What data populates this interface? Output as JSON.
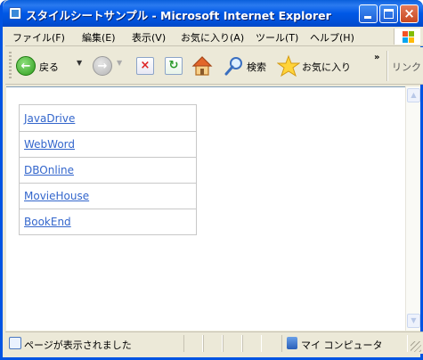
{
  "window": {
    "title": "スタイルシートサンプル - Microsoft Internet Explorer"
  },
  "menu": {
    "items": [
      "ファイル(F)",
      "編集(E)",
      "表示(V)",
      "お気に入り(A)",
      "ツール(T)",
      "ヘルプ(H)"
    ]
  },
  "toolbar": {
    "back_label": "戻る",
    "search_label": "検索",
    "favorites_label": "お気に入り",
    "links_label": "リンク",
    "more_glyph": "»"
  },
  "content": {
    "links": [
      "JavaDrive",
      "WebWord",
      "DBOnline",
      "MovieHouse",
      "BookEnd"
    ]
  },
  "status": {
    "text": "ページが表示されました",
    "zone": "マイ コンピュータ"
  },
  "colors": {
    "link": "#3366cc",
    "titlebar": "#0058e6",
    "chrome": "#ece9d8"
  }
}
